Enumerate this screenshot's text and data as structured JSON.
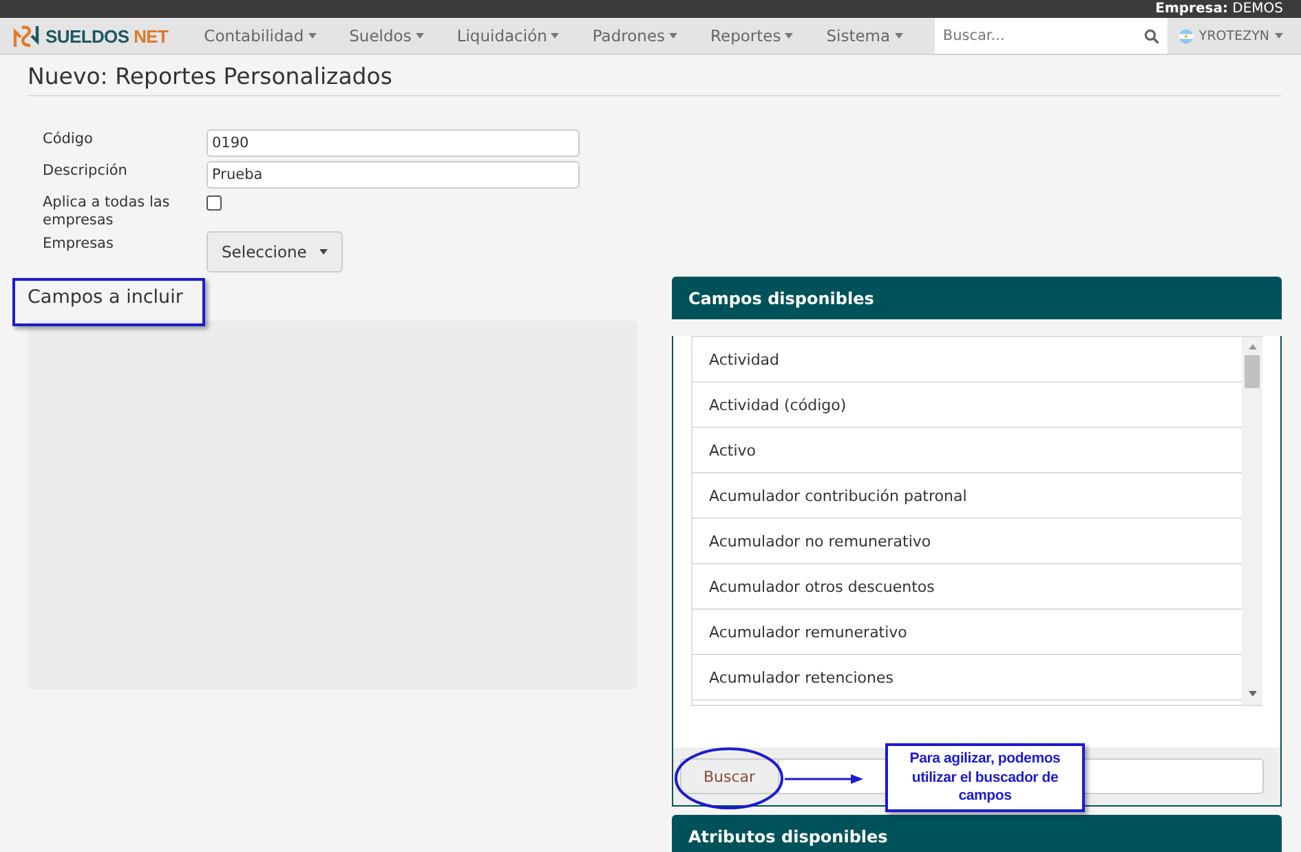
{
  "top_bar": {
    "company_label": "Empresa:",
    "company": "DEMOS"
  },
  "nav": {
    "logo": {
      "name": "SUELDOS",
      "suffix": "NET"
    },
    "menus": [
      "Contabilidad",
      "Sueldos",
      "Liquidación",
      "Padrones",
      "Reportes",
      "Sistema"
    ],
    "search": {
      "placeholder": "Buscar..."
    },
    "user": "YROTEZYN"
  },
  "page_title": "Nuevo: Reportes Personalizados",
  "form": {
    "fields": [
      {
        "kind": "text",
        "label": "Código",
        "value": "0190"
      },
      {
        "kind": "text",
        "label": "Descripción",
        "value": "Prueba"
      },
      {
        "kind": "checkbox",
        "label": "Aplica a todas las empresas",
        "checked": false
      },
      {
        "kind": "dropdown",
        "label": "Empresas",
        "value": "Seleccione"
      }
    ]
  },
  "included_fields": {
    "title": "Campos a incluir"
  },
  "available_fields": {
    "title": "Campos disponibles",
    "items": [
      "Actividad",
      "Actividad (código)",
      "Activo",
      "Acumulador contribución patronal",
      "Acumulador no remunerativo",
      "Acumulador otros descuentos",
      "Acumulador remunerativo",
      "Acumulador retenciones"
    ],
    "search_button": "Buscar"
  },
  "available_attributes": {
    "title": "Atributos disponibles"
  },
  "annotation": {
    "callout": "Para agilizar, podemos utilizar el buscador de campos"
  }
}
